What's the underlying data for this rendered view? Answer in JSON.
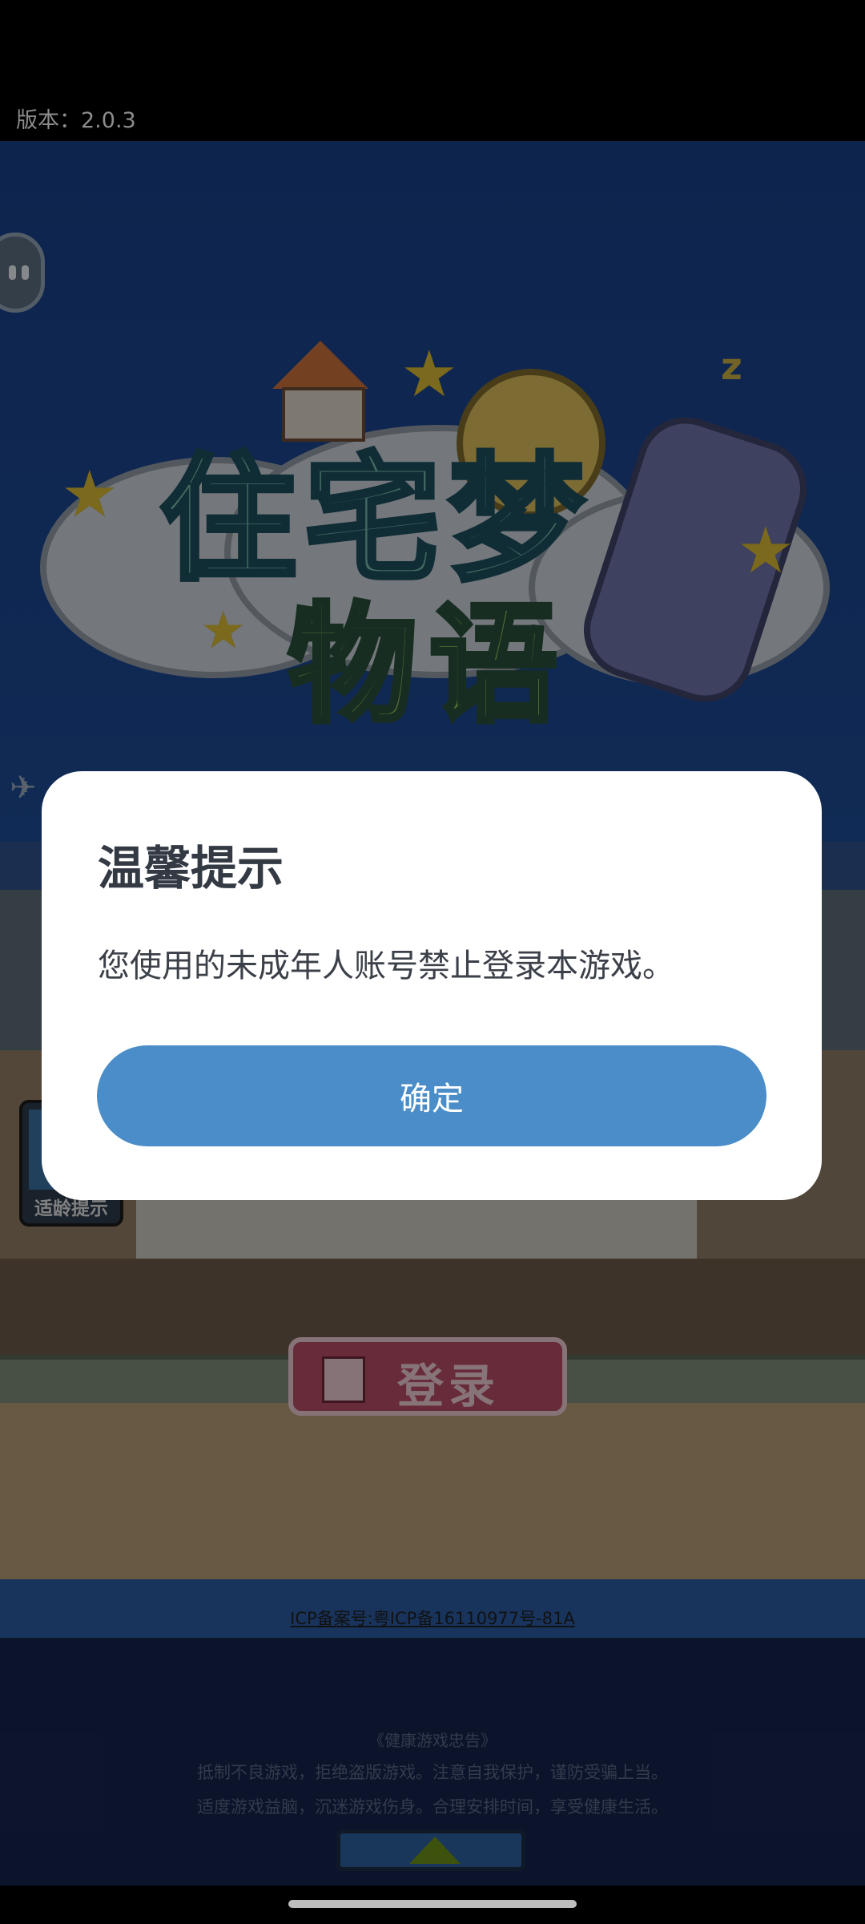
{
  "app": {
    "version_text": "版本：2.0.3"
  },
  "game": {
    "logo_line1": "住宅梦",
    "logo_line2": "物语",
    "login_label": "登录",
    "age_badge_label": "适龄提示",
    "icp_text": "ICP备案号:粤ICP备16110977号-81A",
    "health_title": "《健康游戏忠告》",
    "health_line1": "抵制不良游戏，拒绝盗版游戏。注意自我保护，谨防受骗上当。",
    "health_line2": "适度游戏益脑，沉迷游戏伤身。合理安排时间，享受健康生活。"
  },
  "dialog": {
    "title": "温馨提示",
    "message": "您使用的未成年人账号禁止登录本游戏。",
    "confirm_label": "确定"
  },
  "colors": {
    "accent": "#4a8dc8",
    "background_top": "#183f86",
    "dialog_bg": "#ffffff"
  }
}
